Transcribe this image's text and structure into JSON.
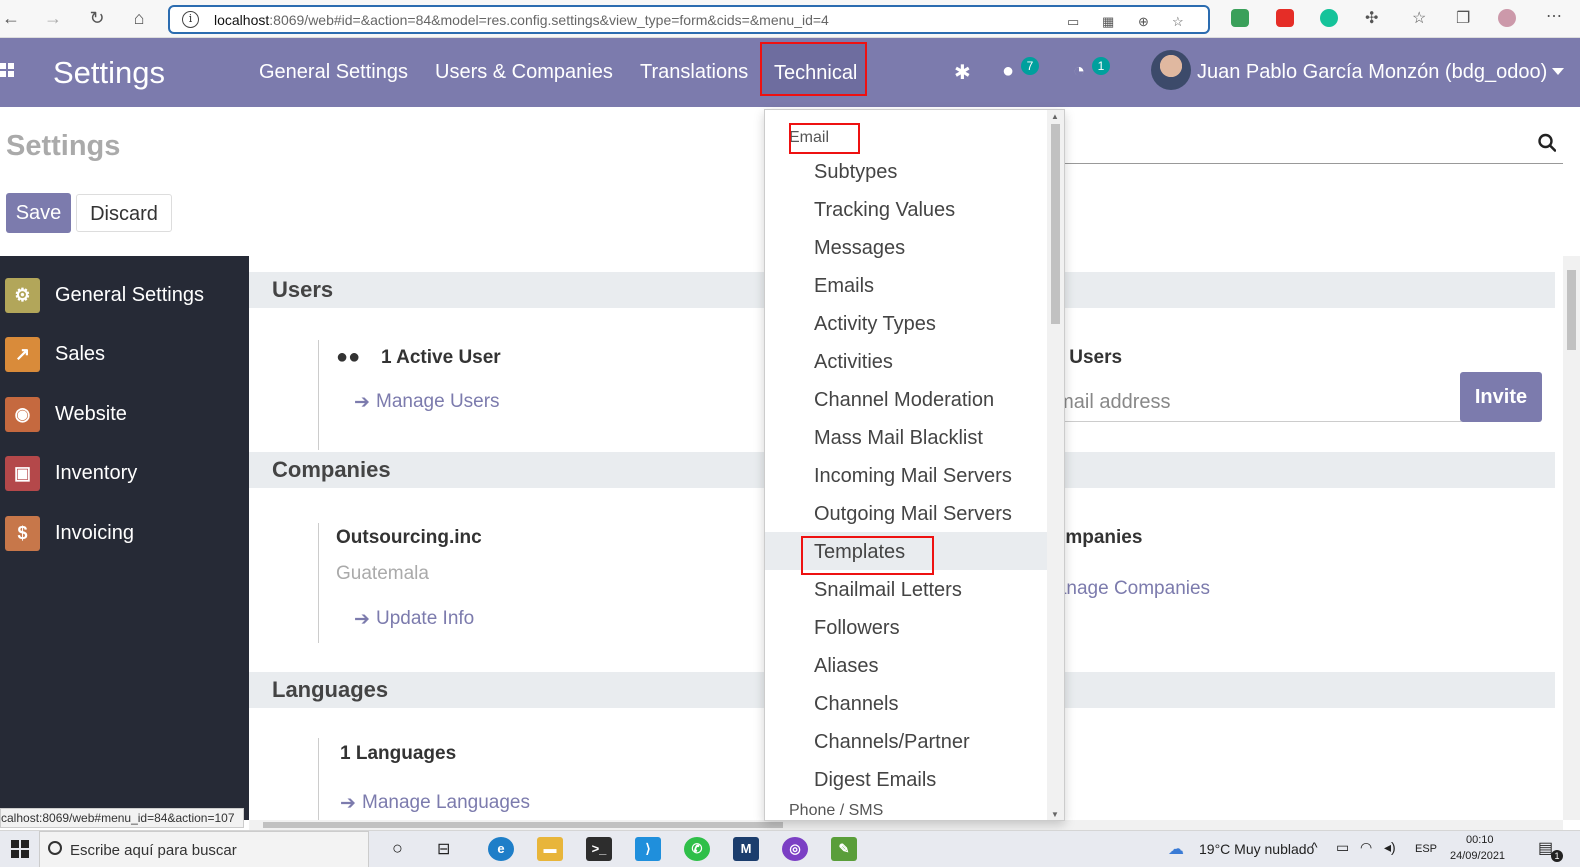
{
  "browser": {
    "url_host": "localhost",
    "url_rest": ":8069/web#id=&action=84&model=res.config.settings&view_type=form&cids=&menu_id=4"
  },
  "navbar": {
    "brand": "Settings",
    "links": [
      "General Settings",
      "Users & Companies",
      "Translations"
    ],
    "active_link": "Technical",
    "messages_badge": "7",
    "activities_badge": "1",
    "user": "Juan Pablo García Monzón (bdg_odoo)"
  },
  "control_panel": {
    "title": "Settings",
    "save_label": "Save",
    "discard_label": "Discard"
  },
  "sidebar": {
    "items": [
      {
        "label": "General Settings",
        "icon": "gear-icon"
      },
      {
        "label": "Sales",
        "icon": "chart-icon"
      },
      {
        "label": "Website",
        "icon": "globe-icon"
      },
      {
        "label": "Inventory",
        "icon": "box-icon"
      },
      {
        "label": "Invoicing",
        "icon": "invoice-icon"
      }
    ]
  },
  "status_url": "calhost:8069/web#menu_id=84&action=107",
  "main": {
    "users_header": "Users",
    "active_users": "1 Active User",
    "manage_users": "Manage Users",
    "invite_title": "Invite New Users",
    "invite_placeholder": "Enter e-mail address",
    "invite_button": "Invite",
    "companies_header": "Companies",
    "company_name": "Outsourcing.inc",
    "company_country": "Guatemala",
    "update_info": "Update Info",
    "multi_companies": "Companies",
    "manage_companies": "Manage Companies",
    "languages_header": "Languages",
    "languages_count": "1 Languages",
    "manage_languages": "Manage Languages"
  },
  "dropdown": {
    "header": "Email",
    "items": [
      "Subtypes",
      "Tracking Values",
      "Messages",
      "Emails",
      "Activity Types",
      "Activities",
      "Channel Moderation",
      "Mass Mail Blacklist",
      "Incoming Mail Servers",
      "Outgoing Mail Servers",
      "Templates",
      "Snailmail Letters",
      "Followers",
      "Aliases",
      "Channels",
      "Channels/Partner",
      "Digest Emails"
    ],
    "active_item": "Templates",
    "next_header": "Phone / SMS"
  },
  "taskbar": {
    "search_placeholder": "Escribe aquí para buscar",
    "weather": "19°C  Muy nublado",
    "lang": "ESP",
    "time": "00:10",
    "date": "24/09/2021",
    "notif_count": "1"
  },
  "colors": {
    "brand": "#7c7bad",
    "sidebar_bg": "#262a36",
    "highlight_border": "#e11111",
    "badge": "#00a09d"
  }
}
